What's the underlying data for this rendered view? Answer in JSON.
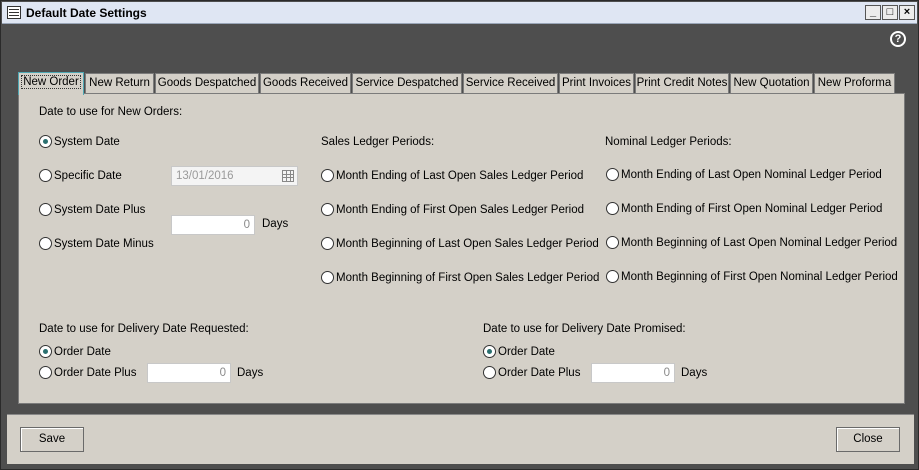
{
  "window": {
    "title": "Default Date Settings",
    "minimize_glyph": "_",
    "maximize_glyph": "□",
    "close_glyph": "×",
    "help_glyph": "?"
  },
  "tabs": [
    {
      "label": "New Order",
      "active": true
    },
    {
      "label": "New Return"
    },
    {
      "label": "Goods Despatched"
    },
    {
      "label": "Goods Received"
    },
    {
      "label": "Service Despatched"
    },
    {
      "label": "Service Received"
    },
    {
      "label": "Print Invoices"
    },
    {
      "label": "Print Credit Notes"
    },
    {
      "label": "New Quotation"
    },
    {
      "label": "New Proforma"
    }
  ],
  "new_order": {
    "heading": "Date to use for New Orders:",
    "options": {
      "system_date": "System Date",
      "specific_date": "Specific Date",
      "system_date_plus": "System Date Plus",
      "system_date_minus": "System Date Minus"
    },
    "selected": "System Date",
    "specific_date_value": "13/01/2016",
    "days_value": "0",
    "days_label": "Days"
  },
  "sales_ledger": {
    "heading": "Sales Ledger Periods:",
    "options": [
      "Month Ending of Last Open Sales Ledger Period",
      "Month Ending of First Open Sales Ledger Period",
      "Month Beginning of Last Open Sales Ledger Period",
      "Month Beginning of First Open Sales Ledger Period"
    ]
  },
  "nominal_ledger": {
    "heading": "Nominal Ledger Periods:",
    "options": [
      "Month Ending of Last Open Nominal Ledger Period",
      "Month Ending of First Open Nominal Ledger Period",
      "Month Beginning of Last Open Nominal Ledger Period",
      "Month Beginning of First Open Nominal Ledger Period"
    ]
  },
  "delivery_requested": {
    "heading": "Date to use for Delivery Date Requested:",
    "order_date": "Order Date",
    "order_date_plus": "Order Date Plus",
    "selected": "Order Date",
    "days_value": "0",
    "days_label": "Days"
  },
  "delivery_promised": {
    "heading": "Date to use for Delivery Date Promised:",
    "order_date": "Order Date",
    "order_date_plus": "Order Date Plus",
    "selected": "Order Date",
    "days_value": "0",
    "days_label": "Days"
  },
  "footer": {
    "save_label": "Save",
    "close_label": "Close"
  }
}
